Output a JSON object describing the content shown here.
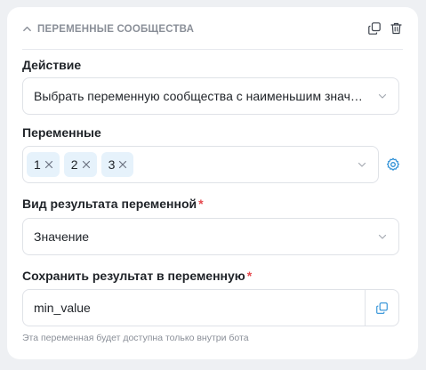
{
  "block": {
    "title": "ПЕРЕМЕННЫЕ СООБЩЕСТВА"
  },
  "action": {
    "label": "Действие",
    "value": "Выбрать переменную сообщества с наименьшим значен..."
  },
  "variables": {
    "label": "Переменные",
    "tags": [
      "1",
      "2",
      "3"
    ]
  },
  "result_type": {
    "label": "Вид результата переменной",
    "required_mark": "*",
    "value": "Значение"
  },
  "save_to": {
    "label": "Сохранить результат в переменную",
    "required_mark": "*",
    "value": "min_value",
    "hint": "Эта переменная будет доступна только внутри бота"
  },
  "colors": {
    "accent": "#2b8fd6",
    "required": "#e5484d",
    "tag_bg": "#e6f2fb"
  }
}
